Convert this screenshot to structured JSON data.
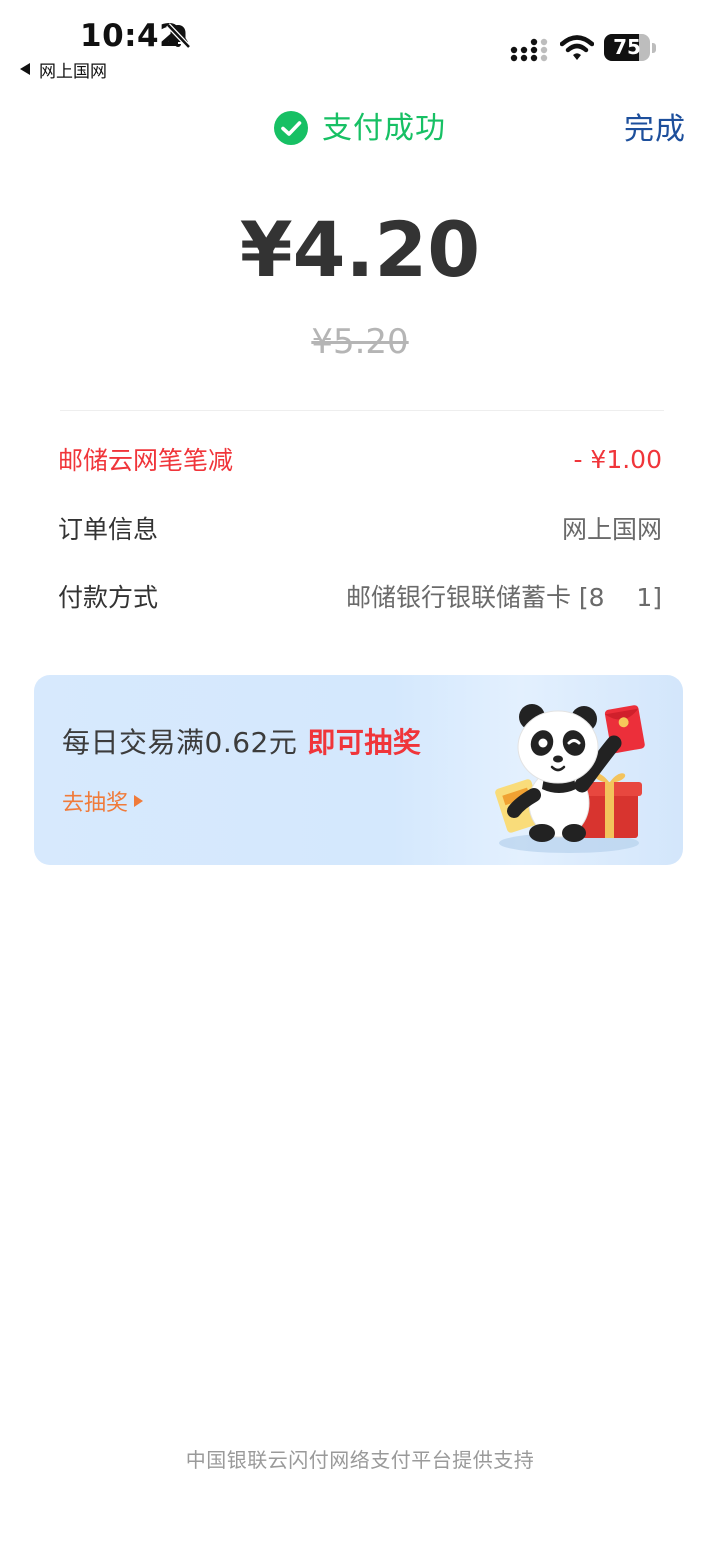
{
  "status_bar": {
    "time": "10:42",
    "back_app": "网上国网",
    "battery_level": "75",
    "battery_fraction": 0.75
  },
  "header": {
    "status_text": "支付成功",
    "done_label": "完成"
  },
  "payment": {
    "amount": "¥4.20",
    "original_amount": "¥5.20"
  },
  "details": [
    {
      "label": "邮储云网笔笔减",
      "value": "- ¥1.00"
    },
    {
      "label": "订单信息",
      "value": "网上国网"
    },
    {
      "label": "付款方式",
      "value": "邮储银行银联储蓄卡 [8    1]"
    }
  ],
  "promo": {
    "title": "每日交易满0.62元",
    "highlight": "即可抽奖",
    "action_label": "去抽奖"
  },
  "footer": {
    "text": "中国银联云闪付网络支付平台提供支持"
  },
  "colors": {
    "success_green": "#17c064",
    "link_blue": "#1d4f9c",
    "discount_red": "#f0353a",
    "promo_orange": "#f07b3a"
  },
  "icons": [
    "bell-slash-icon",
    "back-arrow-icon",
    "signal-icon",
    "wifi-icon",
    "battery-icon",
    "check-circle-icon",
    "play-triangle-icon"
  ]
}
